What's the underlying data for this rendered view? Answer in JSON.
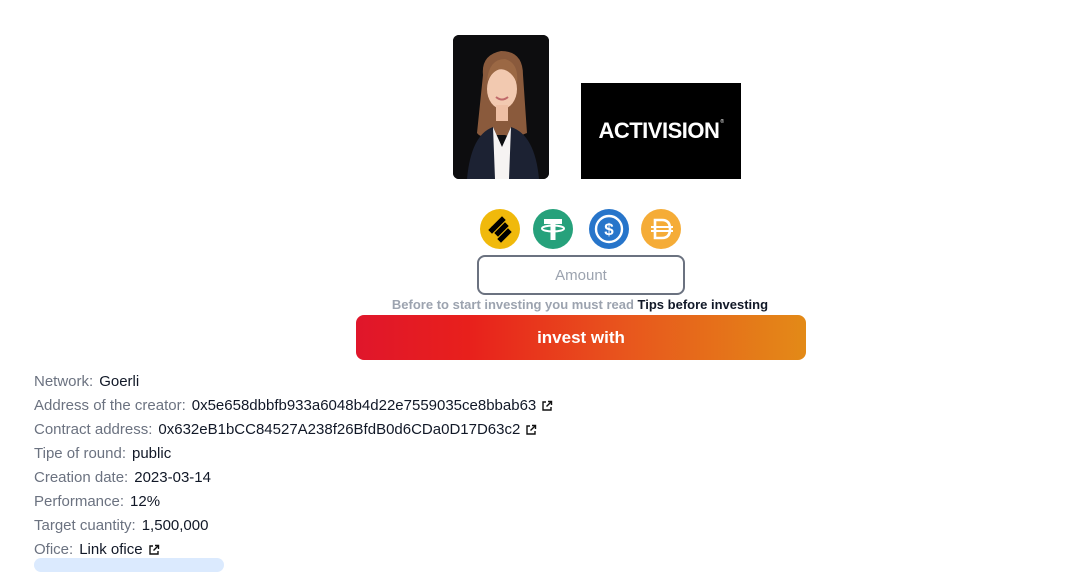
{
  "media": {
    "portrait_alt": "Creator portrait",
    "brand_logo": "ACTIVISION"
  },
  "tokens": [
    {
      "name": "busd-icon",
      "color": "#F0B90B"
    },
    {
      "name": "usdt-icon",
      "color": "#26A17B"
    },
    {
      "name": "usdc-icon",
      "color": "#2775CA"
    },
    {
      "name": "dai-icon",
      "color": "#F5AC37"
    }
  ],
  "form": {
    "amount_placeholder": "Amount",
    "tips_prefix": "Before to start investing you must read",
    "tips_link": "Tips before investing",
    "invest_label": "invest with"
  },
  "details": {
    "network_label": "Network:",
    "network_value": "Goerli",
    "creator_label": "Address of the creator:",
    "creator_value": "0x5e658dbbfb933a6048b4d22e7559035ce8bbab63",
    "contract_label": "Contract address:",
    "contract_value": "0x632eB1bCC84527A238f26BfdB0d6CDa0D17D63c2",
    "round_label": "Tipe of round:",
    "round_value": "public",
    "date_label": "Creation date:",
    "date_value": "2023-03-14",
    "performance_label": "Performance:",
    "performance_value": "12%",
    "target_label": "Target cuantity:",
    "target_value": "1,500,000",
    "office_label": "Ofice:",
    "office_value": "Link ofice"
  },
  "colors": {
    "gradient_start": "#e0162b",
    "gradient_end": "#e38a17"
  }
}
